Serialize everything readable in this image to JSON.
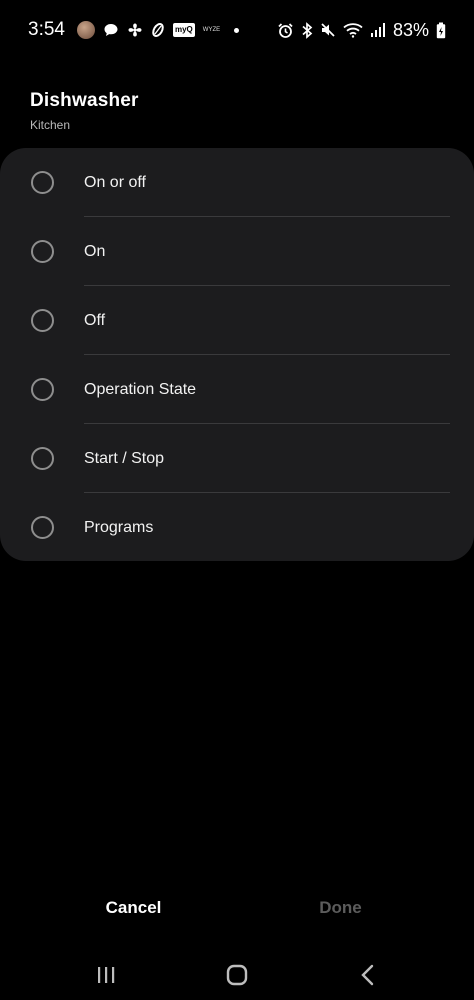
{
  "status_bar": {
    "time": "3:54",
    "battery": "83%",
    "left_icons": [
      "avatar-icon",
      "chat-bubble-icon",
      "fan-icon",
      "leaf-icon",
      "myq-icon",
      "small-text-icon",
      "notification-dot-icon"
    ],
    "myq_label": "myQ",
    "small_label": "WYZE",
    "right_icons": [
      "alarm-icon",
      "bluetooth-icon",
      "mute-icon",
      "wifi-icon",
      "signal-icon",
      "battery-icon"
    ]
  },
  "header": {
    "title": "Dishwasher",
    "subtitle": "Kitchen"
  },
  "options": [
    {
      "label": "On or off",
      "selected": false
    },
    {
      "label": "On",
      "selected": false
    },
    {
      "label": "Off",
      "selected": false
    },
    {
      "label": "Operation State",
      "selected": false
    },
    {
      "label": "Start / Stop",
      "selected": false
    },
    {
      "label": "Programs",
      "selected": false
    }
  ],
  "actions": {
    "cancel_label": "Cancel",
    "done_label": "Done"
  },
  "nav": {
    "icons": [
      "recent-apps-icon",
      "home-icon",
      "back-icon"
    ]
  },
  "colors": {
    "background": "#000000",
    "card": "#1c1c1e",
    "text_primary": "#ffffff",
    "text_disabled": "#5c5c5c",
    "radio_border": "#8e8e8e"
  }
}
